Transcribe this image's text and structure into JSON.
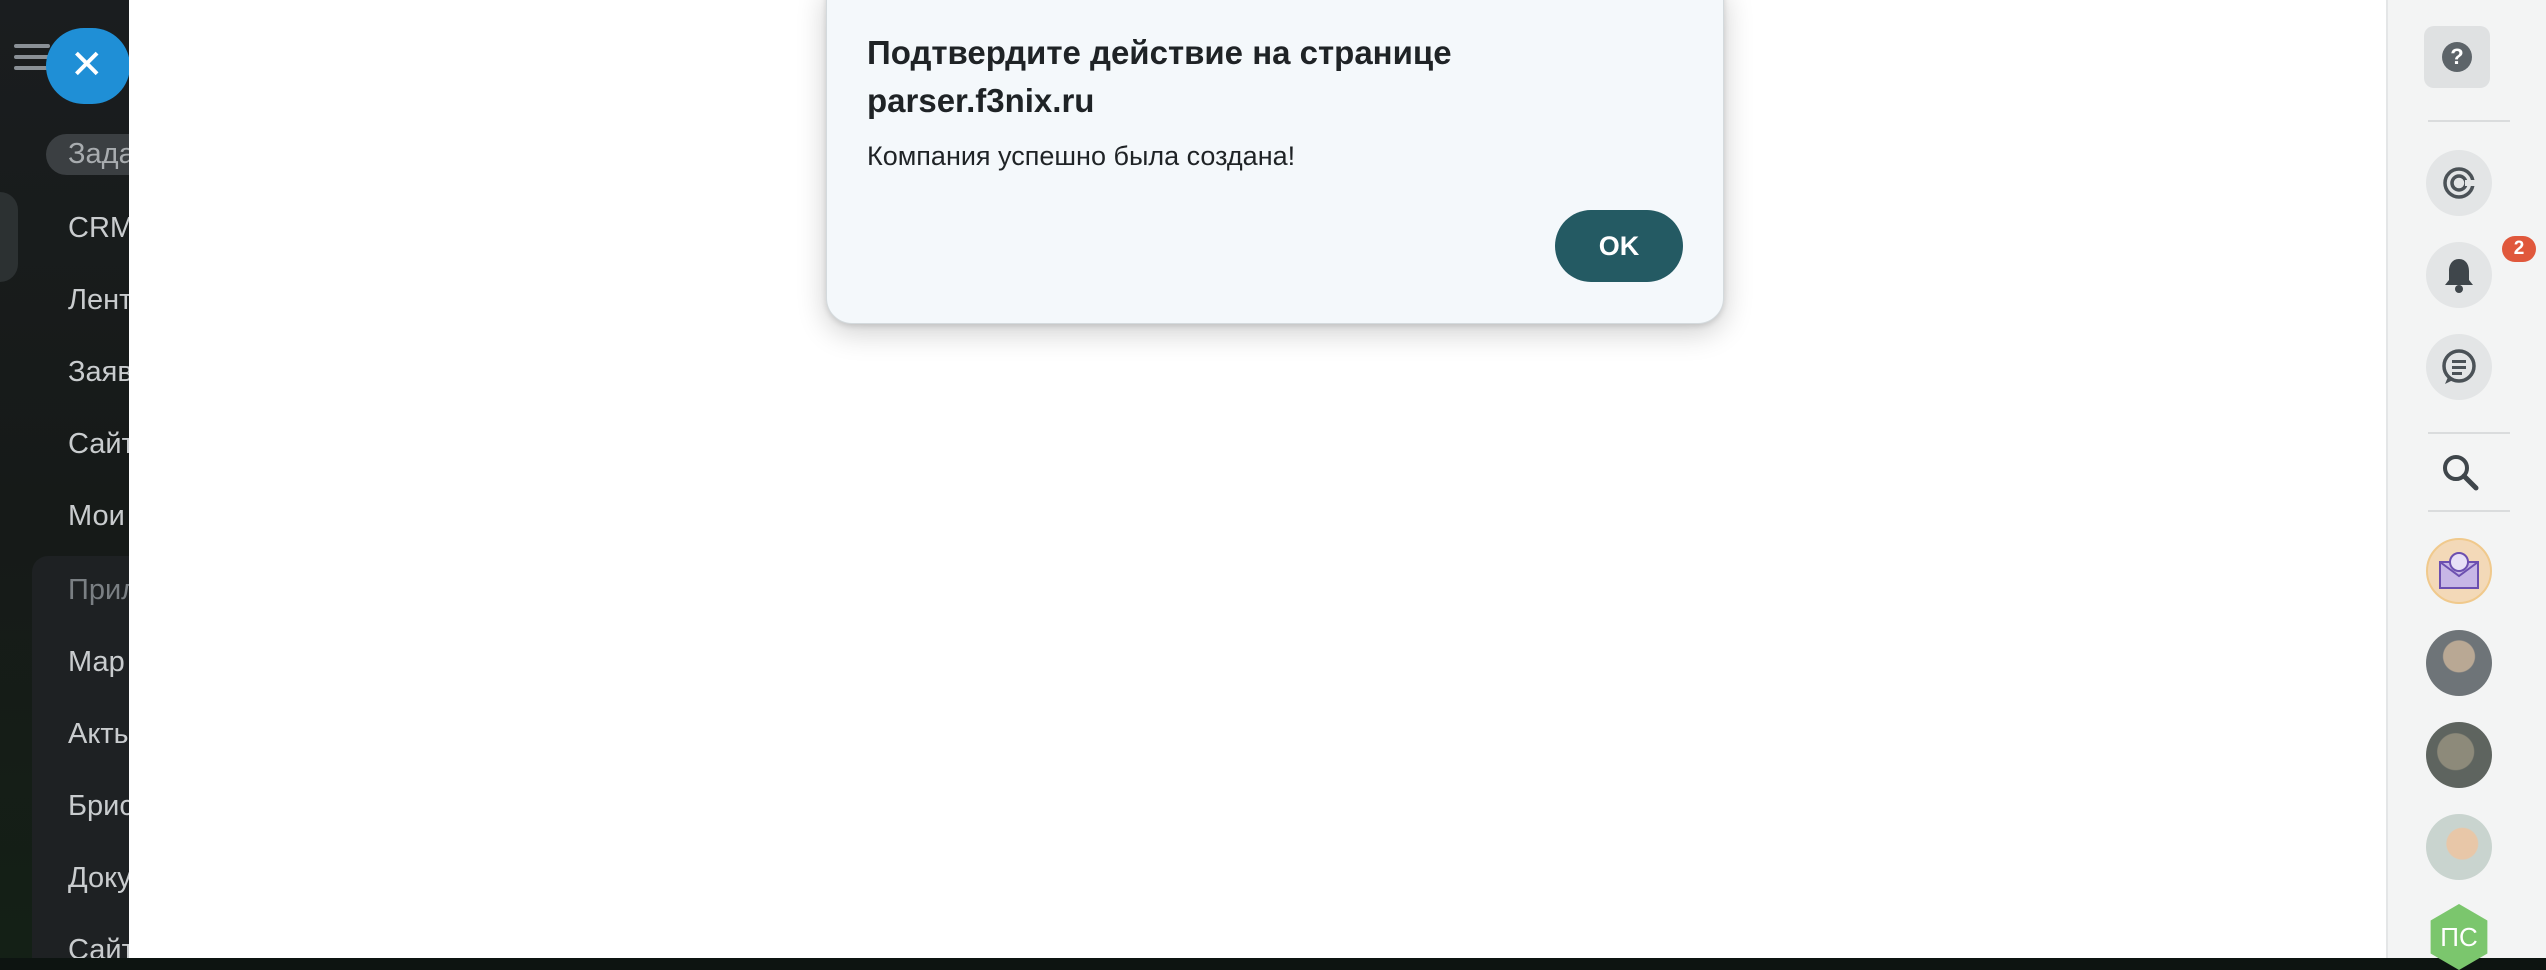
{
  "dialog": {
    "title": "Подтвердите действие на странице parser.f3nix.ru",
    "message": "Компания успешно была создана!",
    "ok_label": "OK"
  },
  "sidebar": {
    "items": [
      {
        "label": "Зада",
        "style": "pill"
      },
      {
        "label": "CRM"
      },
      {
        "label": "Лент"
      },
      {
        "label": "Заяв"
      },
      {
        "label": "Сайт"
      },
      {
        "label": "Мои"
      },
      {
        "label": "Прил",
        "style": "muted"
      },
      {
        "label": "Мар"
      },
      {
        "label": "Акты"
      },
      {
        "label": "Брис"
      },
      {
        "label": "Доку"
      },
      {
        "label": "Сайт"
      }
    ]
  },
  "rail": {
    "notifications_count": "2",
    "avatar_initials": "ПС"
  },
  "colors": {
    "ok_button": "#245a63",
    "close_button": "#1f8fd6",
    "badge": "#e0583c"
  }
}
